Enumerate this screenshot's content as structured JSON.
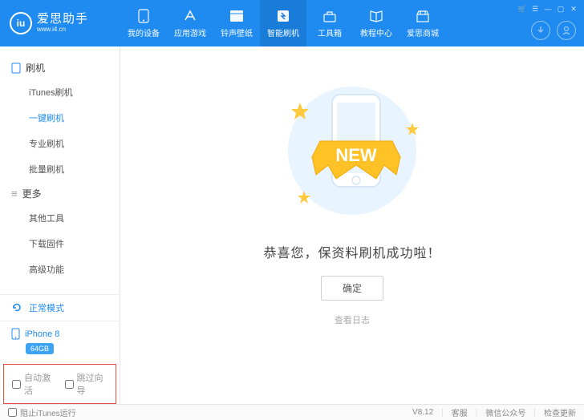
{
  "app": {
    "logo_text": "iu",
    "title": "爱思助手",
    "subtitle": "www.i4.cn"
  },
  "nav": {
    "items": [
      {
        "label": "我的设备"
      },
      {
        "label": "应用游戏"
      },
      {
        "label": "铃声壁纸"
      },
      {
        "label": "智能刷机"
      },
      {
        "label": "工具箱"
      },
      {
        "label": "教程中心"
      },
      {
        "label": "爱思商城"
      }
    ],
    "active_index": 3
  },
  "sidebar": {
    "section1_label": "刷机",
    "section1_items": [
      {
        "label": "iTunes刷机"
      },
      {
        "label": "一键刷机"
      },
      {
        "label": "专业刷机"
      },
      {
        "label": "批量刷机"
      }
    ],
    "section1_active_index": 1,
    "section2_label": "更多",
    "section2_items": [
      {
        "label": "其他工具"
      },
      {
        "label": "下载固件"
      },
      {
        "label": "高级功能"
      }
    ],
    "mode_label": "正常模式",
    "device_name": "iPhone 8",
    "device_storage": "64GB",
    "checks": {
      "auto_activate": "自动激活",
      "skip_guide": "跳过向导"
    }
  },
  "main": {
    "new_text": "NEW",
    "success_message": "恭喜您，保资料刷机成功啦！",
    "confirm_label": "确定",
    "view_log_label": "查看日志"
  },
  "footer": {
    "prevent_itunes": "阻止iTunes运行",
    "version": "V8.12",
    "support": "客服",
    "wechat": "微信公众号",
    "update": "检查更新"
  }
}
